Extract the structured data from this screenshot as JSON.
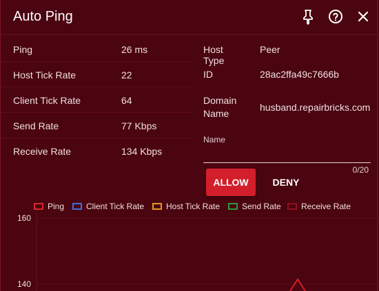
{
  "header": {
    "title": "Auto Ping",
    "icons": [
      "pin-icon",
      "help-icon",
      "close-icon"
    ]
  },
  "stats": [
    {
      "label": "Ping",
      "value": "26 ms"
    },
    {
      "label": "Host Tick Rate",
      "value": "22"
    },
    {
      "label": "Client Tick Rate",
      "value": "64"
    },
    {
      "label": "Send Rate",
      "value": "77 Kbps"
    },
    {
      "label": "Receive Rate",
      "value": "134 Kbps"
    }
  ],
  "info": {
    "host_type_label": "Host Type",
    "host_type_value": "Peer",
    "id_label": "ID",
    "id_value": "28ac2ffa49c7666b",
    "domain_label_1": "Domain",
    "domain_label_2": "Name",
    "domain_value": "husband.repairbricks.com"
  },
  "name_field": {
    "label": "Name",
    "value": "",
    "counter": "0/20"
  },
  "actions": {
    "allow_label": "ALLOW",
    "deny_label": "DENY"
  },
  "colors": {
    "background": "#4a0510",
    "allow": "#d21f2b"
  },
  "chart_data": {
    "type": "line",
    "series": [
      {
        "name": "Ping",
        "color": "#d8262e"
      },
      {
        "name": "Client Tick Rate",
        "color": "#3d6fe0"
      },
      {
        "name": "Host Tick Rate",
        "color": "#e39a1c"
      },
      {
        "name": "Send Rate",
        "color": "#2e9c3a"
      },
      {
        "name": "Receive Rate",
        "color": "#8f1020"
      }
    ],
    "y_ticks": [
      "160",
      "140"
    ],
    "ylim": [
      130,
      160
    ],
    "grid": false,
    "legend": "top"
  }
}
